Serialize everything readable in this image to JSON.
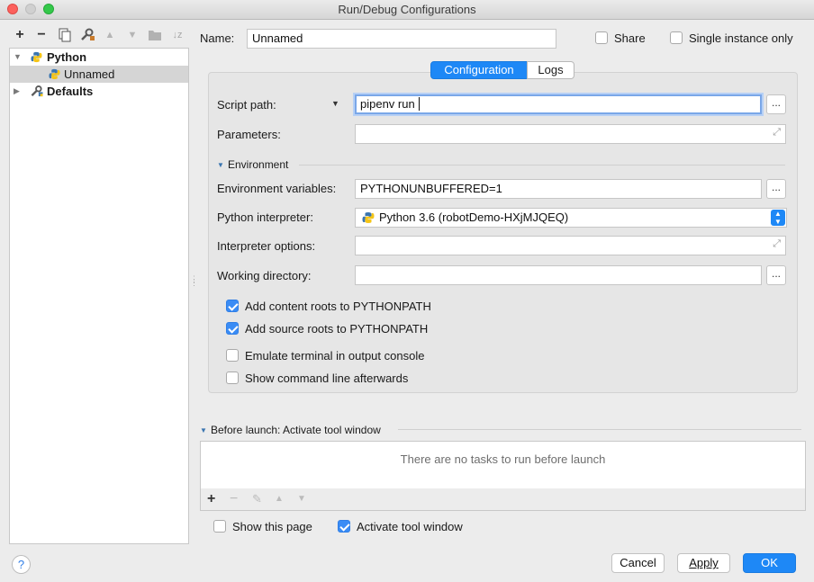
{
  "window": {
    "title": "Run/Debug Configurations"
  },
  "toolbar": {
    "add": "+",
    "remove": "−",
    "sort": "↓z"
  },
  "tree": {
    "items": [
      {
        "label": "Python",
        "expanded": true
      },
      {
        "label": "Unnamed",
        "selected": true
      },
      {
        "label": "Defaults",
        "expanded": false
      }
    ]
  },
  "header": {
    "name_label": "Name:",
    "name_value": "Unnamed",
    "share_label": "Share",
    "share_checked": false,
    "single_instance_label": "Single instance only",
    "single_instance_checked": false
  },
  "tabs": [
    {
      "label": "Configuration",
      "active": true
    },
    {
      "label": "Logs",
      "active": false
    }
  ],
  "form": {
    "script_path_label": "Script path:",
    "script_path_value": "pipenv run",
    "parameters_label": "Parameters:",
    "parameters_value": "",
    "environment_section": "Environment",
    "env_vars_label": "Environment variables:",
    "env_vars_value": "PYTHONUNBUFFERED=1",
    "interpreter_label": "Python interpreter:",
    "interpreter_value": "Python 3.6 (robotDemo-HXjMJQEQ)",
    "interp_options_label": "Interpreter options:",
    "interp_options_value": "",
    "working_dir_label": "Working directory:",
    "working_dir_value": "",
    "browse": "...",
    "checkboxes": [
      {
        "label": "Add content roots to PYTHONPATH",
        "checked": true
      },
      {
        "label": "Add source roots to PYTHONPATH",
        "checked": true
      },
      {
        "label": "Emulate terminal in output console",
        "checked": false
      },
      {
        "label": "Show command line afterwards",
        "checked": false
      }
    ]
  },
  "before_launch": {
    "title": "Before launch: Activate tool window",
    "empty_text": "There are no tasks to run before launch",
    "add": "+",
    "remove": "−"
  },
  "footer": {
    "show_page_label": "Show this page",
    "show_page_checked": false,
    "activate_label": "Activate tool window",
    "activate_checked": true,
    "help": "?",
    "cancel": "Cancel",
    "apply": "Apply",
    "ok": "OK"
  },
  "colors": {
    "accent": "#1e88f6",
    "checkbox": "#3a8cf5",
    "focus": "#7aa7e8"
  }
}
